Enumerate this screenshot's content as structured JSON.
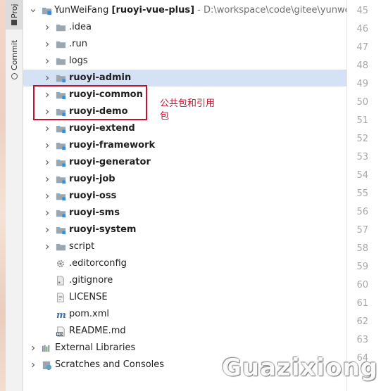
{
  "toolstrip": {
    "project_tab": "Proj",
    "commit_tab": "Commit"
  },
  "tree": {
    "root": {
      "name": "YunWeiFang",
      "module": "[ruoyi-vue-plus]",
      "path": "- D:\\workspace\\code\\gitee\\yunweifang\\"
    },
    "items": [
      {
        "label": ".idea",
        "type": "folder",
        "bold": false
      },
      {
        "label": ".run",
        "type": "folder",
        "bold": false
      },
      {
        "label": "logs",
        "type": "folder",
        "bold": false
      },
      {
        "label": "ruoyi-admin",
        "type": "module",
        "bold": true,
        "selected": true
      },
      {
        "label": "ruoyi-common",
        "type": "module",
        "bold": true
      },
      {
        "label": "ruoyi-demo",
        "type": "module",
        "bold": true
      },
      {
        "label": "ruoyi-extend",
        "type": "module",
        "bold": true
      },
      {
        "label": "ruoyi-framework",
        "type": "module",
        "bold": true
      },
      {
        "label": "ruoyi-generator",
        "type": "module",
        "bold": true
      },
      {
        "label": "ruoyi-job",
        "type": "module",
        "bold": true
      },
      {
        "label": "ruoyi-oss",
        "type": "module",
        "bold": true
      },
      {
        "label": "ruoyi-sms",
        "type": "module",
        "bold": true
      },
      {
        "label": "ruoyi-system",
        "type": "module",
        "bold": true
      },
      {
        "label": "script",
        "type": "folder",
        "bold": false
      },
      {
        "label": ".editorconfig",
        "type": "gear-file",
        "bold": false
      },
      {
        "label": ".gitignore",
        "type": "git-file",
        "bold": false
      },
      {
        "label": "LICENSE",
        "type": "text-file",
        "bold": false
      },
      {
        "label": "pom.xml",
        "type": "maven-file",
        "bold": false
      },
      {
        "label": "README.md",
        "type": "markdown-file",
        "bold": false
      }
    ],
    "external_libraries": "External Libraries",
    "scratches": "Scratches and Consoles"
  },
  "annotation": {
    "note": "公共包和引用包",
    "color": "#c8102e"
  },
  "gutter": {
    "line_numbers": [
      "45",
      "46",
      "47",
      "48",
      "49",
      "50",
      "51",
      "52",
      "53",
      "54",
      "55",
      "56",
      "57",
      "58",
      "59",
      "60",
      "61",
      "62",
      "63",
      "64"
    ]
  },
  "watermark": "Guazixiong",
  "colors": {
    "selection": "#d5e1f5",
    "folder": "#9aa7b0",
    "module_dot": "#3d8cd9",
    "annotation": "#c8102e"
  }
}
